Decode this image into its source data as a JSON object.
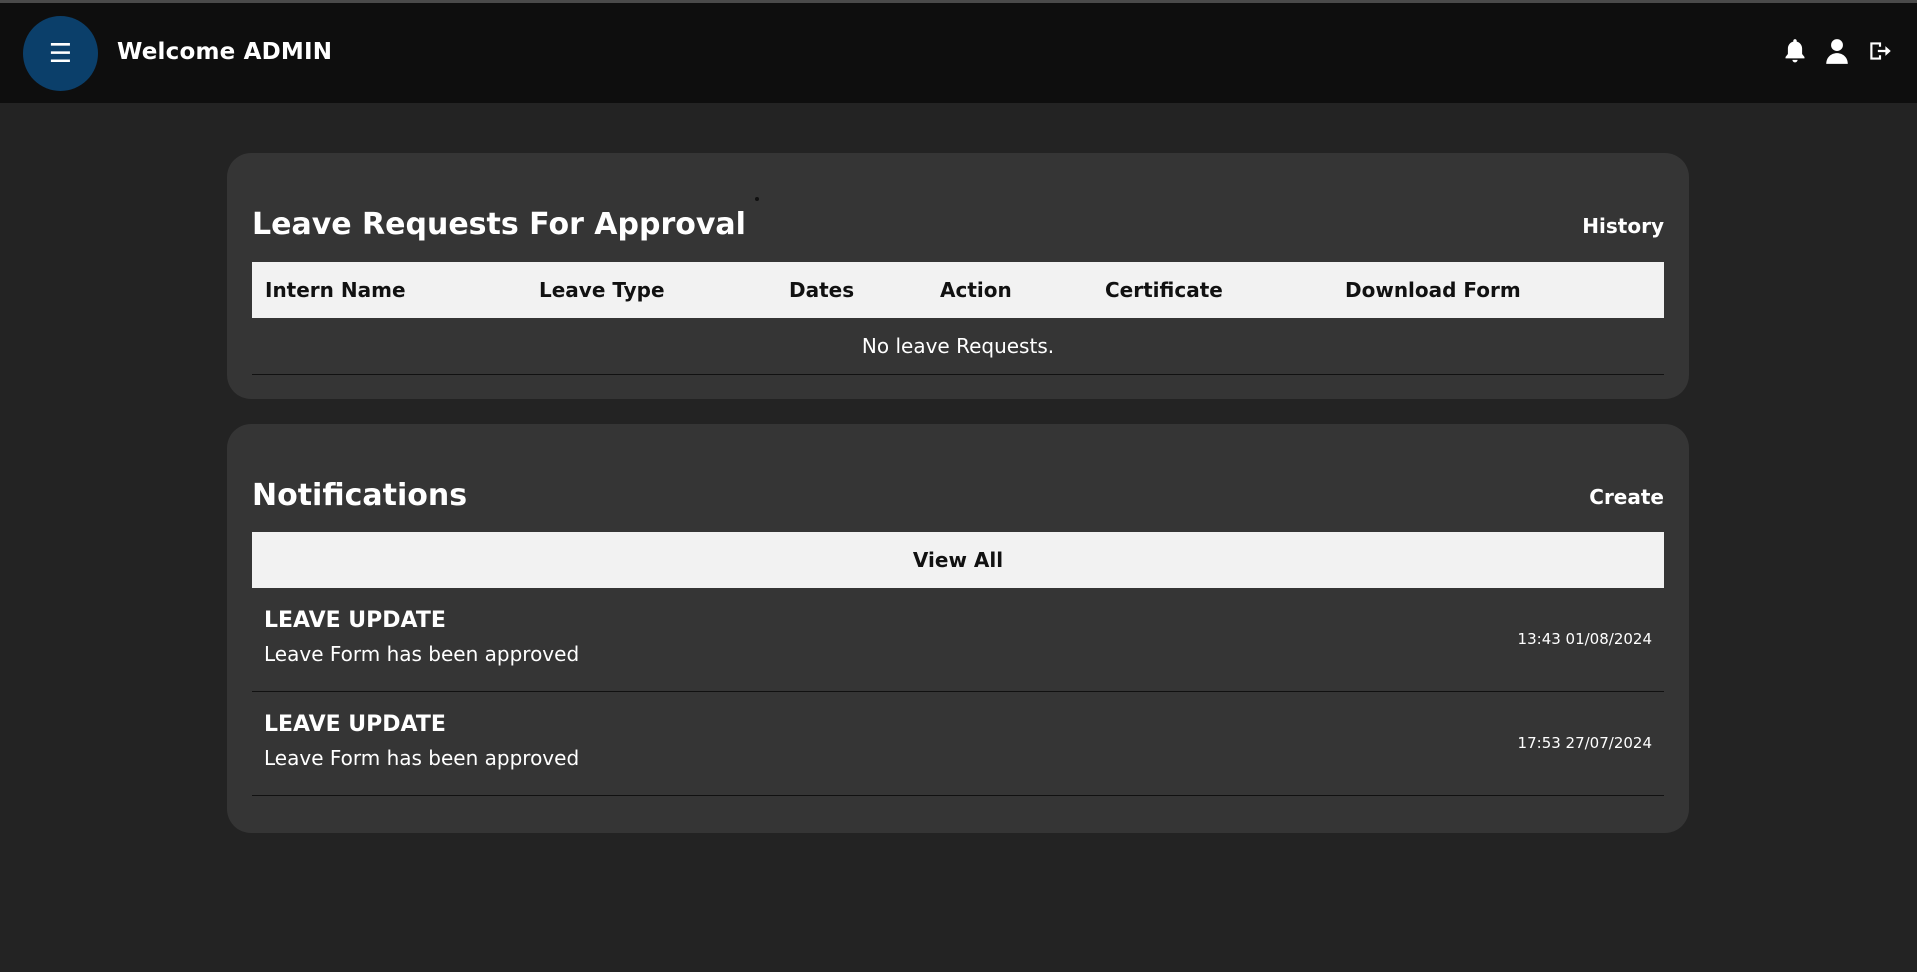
{
  "header": {
    "menu_icon": "☰",
    "welcome": "Welcome ADMIN",
    "icons": [
      "bell-icon",
      "user-icon",
      "logout-icon"
    ]
  },
  "leave_requests": {
    "title": "Leave Requests For Approval",
    "history_link": "History",
    "columns": [
      "Intern Name",
      "Leave Type",
      "Dates",
      "Action",
      "Certificate",
      "Download Form"
    ],
    "empty_message": "No leave Requests."
  },
  "notifications": {
    "title": "Notifications",
    "create_link": "Create",
    "view_all": "View All",
    "items": [
      {
        "title": "LEAVE UPDATE",
        "message": "Leave Form has been approved",
        "time": "13:43 01/08/2024"
      },
      {
        "title": "LEAVE UPDATE",
        "message": "Leave Form has been approved",
        "time": "17:53 27/07/2024"
      }
    ]
  },
  "colors": {
    "background": "#232323",
    "header": "#0e0e0e",
    "card": "#353535",
    "menu_button": "#0b3f6a",
    "table_header": "#f2f2f2"
  }
}
